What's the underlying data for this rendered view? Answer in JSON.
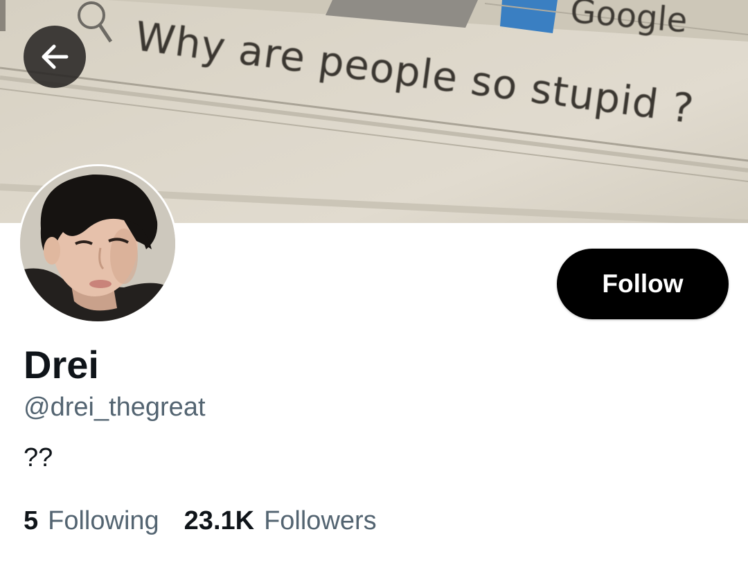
{
  "banner": {
    "search_text": "Why are people so stupid ?",
    "brand_text": "Google"
  },
  "nav": {
    "back_icon": "arrow-left-icon"
  },
  "profile": {
    "follow_label": "Follow",
    "display_name": "Drei",
    "handle": "@drei_thegreat",
    "bio": "??",
    "following_count": "5",
    "following_label": "Following",
    "followers_count": "23.1K",
    "followers_label": "Followers"
  },
  "colors": {
    "primary_text": "#0f1419",
    "secondary_text": "#536471",
    "follow_button_bg": "#000000",
    "follow_button_text": "#ffffff"
  }
}
